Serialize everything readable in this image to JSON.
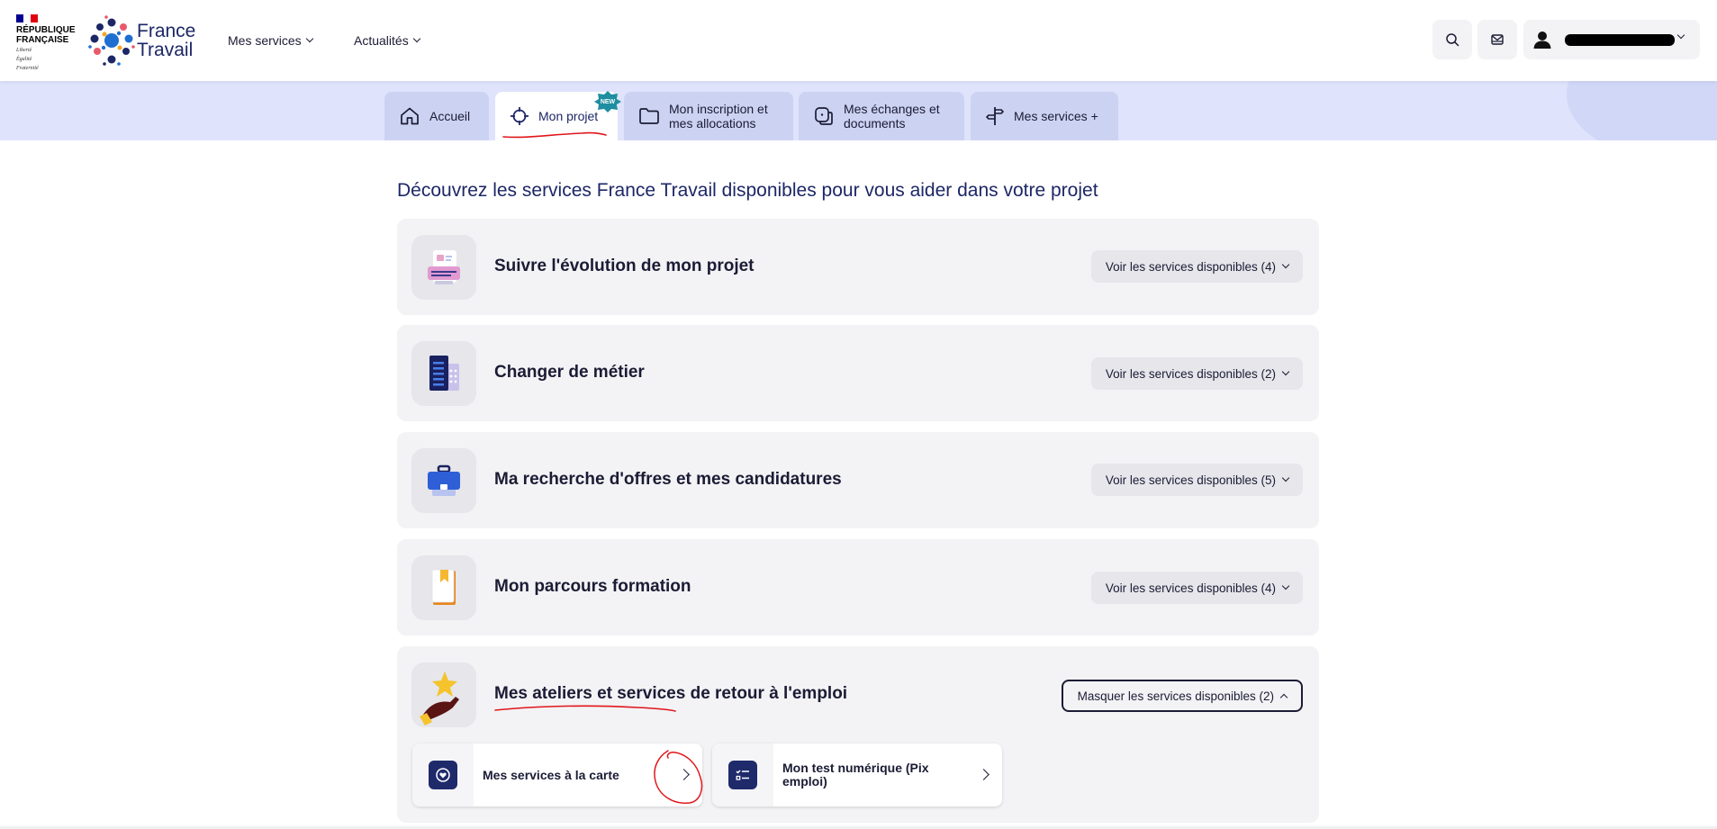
{
  "header": {
    "republique_line1": "RÉPUBLIQUE",
    "republique_line2": "FRANÇAISE",
    "devise_1": "Liberté",
    "devise_2": "Égalité",
    "devise_3": "Fraternité",
    "brand_line1": "France",
    "brand_line2": "Travail",
    "nav": [
      {
        "label": "Mes services"
      },
      {
        "label": "Actualités"
      }
    ],
    "icons": {
      "search": "search-icon",
      "messages": "mail-icon",
      "user": "user-icon"
    }
  },
  "tabs": [
    {
      "label": "Accueil",
      "icon": "home-icon"
    },
    {
      "label": "Mon projet",
      "icon": "target-icon",
      "badge": "NEW"
    },
    {
      "label": "Mon inscription et mes allocations",
      "icon": "folder-icon"
    },
    {
      "label": "Mes échanges et documents",
      "icon": "chat-icon"
    },
    {
      "label": "Mes services +",
      "icon": "signpost-icon"
    }
  ],
  "main": {
    "title": "Découvrez les services France Travail disponibles pour vous aider dans votre projet",
    "cards": [
      {
        "title": "Suivre l'évolution de mon projet",
        "button": "Voir les services disponibles (4)",
        "icon": "document-icon"
      },
      {
        "title": "Changer de métier",
        "button": "Voir les services disponibles (2)",
        "icon": "building-icon"
      },
      {
        "title": "Ma recherche d'offres et mes candidatures",
        "button": "Voir les services disponibles (5)",
        "icon": "briefcase-icon"
      },
      {
        "title": "Mon parcours formation",
        "button": "Voir les services disponibles (4)",
        "icon": "book-icon"
      },
      {
        "title": "Mes ateliers et services de retour à l'emploi",
        "button": "Masquer les services disponibles (2)",
        "icon": "star-hand-icon"
      }
    ],
    "sub_services": [
      {
        "label": "Mes services à la carte",
        "icon": "heart-hand-icon"
      },
      {
        "label": "Mon test numérique (Pix emploi)",
        "icon": "checklist-icon"
      }
    ]
  },
  "colors": {
    "brand": "#1d2766",
    "band": "#dfe3fb",
    "tab": "#ccd3f2",
    "card_bg": "#f3f3f5",
    "annotation": "#e0161b"
  }
}
